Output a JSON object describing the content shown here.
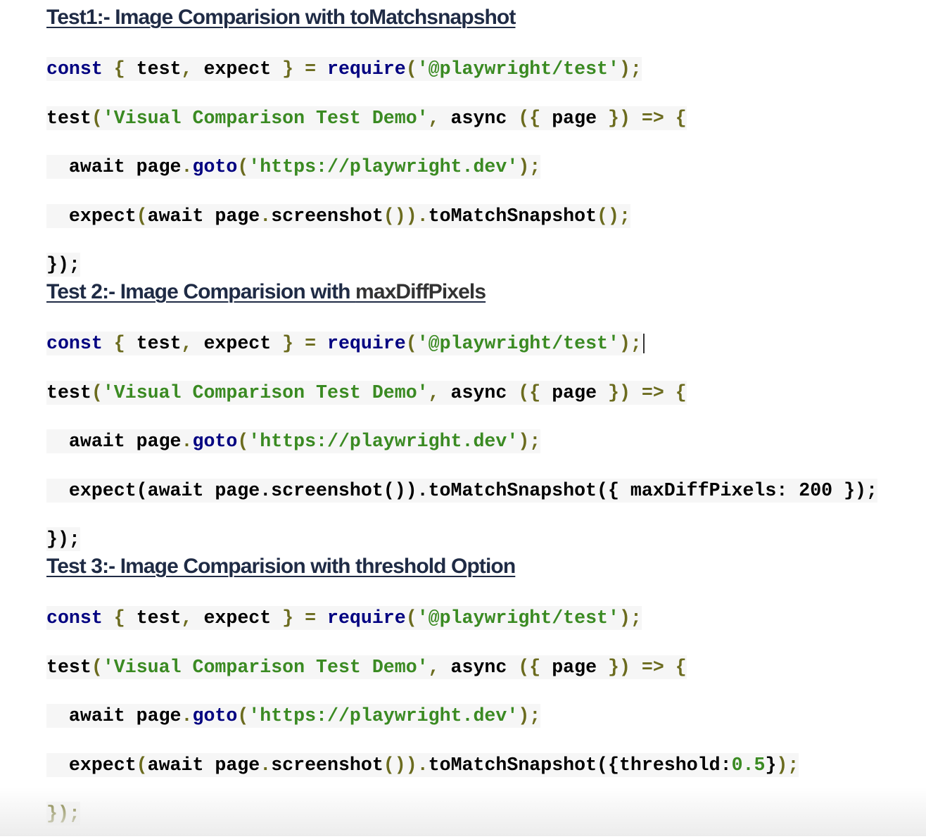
{
  "sections": [
    {
      "heading": "Test1:- Image Comparision with toMatchsnapshot",
      "heading_dark": "",
      "lines": [
        [
          [
            "const",
            "kw"
          ],
          [
            " { ",
            "p"
          ],
          [
            "test",
            "t"
          ],
          [
            ", ",
            "p"
          ],
          [
            "expect",
            "t"
          ],
          [
            " } = ",
            "p"
          ],
          [
            "require",
            "kw"
          ],
          [
            "(",
            "p"
          ],
          [
            "'@playwright/test'",
            "s"
          ],
          [
            ");",
            "p"
          ]
        ],
        [
          [
            "test",
            "t"
          ],
          [
            "(",
            "p"
          ],
          [
            "'Visual Comparison Test Demo'",
            "s"
          ],
          [
            ", ",
            "p"
          ],
          [
            "async",
            "t"
          ],
          [
            " ({ ",
            "p"
          ],
          [
            "page",
            "t"
          ],
          [
            " }) => {",
            "p"
          ]
        ],
        [
          [
            "  await page",
            "t"
          ],
          [
            ".",
            "p"
          ],
          [
            "goto",
            "kw"
          ],
          [
            "(",
            "p"
          ],
          [
            "'https://playwright.dev'",
            "s"
          ],
          [
            ");",
            "p"
          ]
        ],
        [
          [
            "  expect",
            "t"
          ],
          [
            "(",
            "p"
          ],
          [
            "await page",
            "t"
          ],
          [
            ".",
            "p"
          ],
          [
            "screenshot",
            "t"
          ],
          [
            "())",
            "p"
          ],
          [
            ".",
            "p"
          ],
          [
            "toMatchSnapshot",
            "t"
          ],
          [
            "();",
            "p"
          ]
        ],
        [
          [
            "});",
            "t"
          ]
        ]
      ]
    },
    {
      "heading": "Test 2:- Image Comparision with ",
      "heading_dark": "maxDiffPixels",
      "lines": [
        [
          [
            "const",
            "kw"
          ],
          [
            " { ",
            "p"
          ],
          [
            "test",
            "t"
          ],
          [
            ", ",
            "p"
          ],
          [
            "expect",
            "t"
          ],
          [
            " } = ",
            "p"
          ],
          [
            "require",
            "kw"
          ],
          [
            "(",
            "p"
          ],
          [
            "'@playwright/test'",
            "s"
          ],
          [
            ");",
            "p"
          ]
        ],
        [
          [
            "test",
            "t"
          ],
          [
            "(",
            "p"
          ],
          [
            "'Visual Comparison Test Demo'",
            "s"
          ],
          [
            ", ",
            "p"
          ],
          [
            "async",
            "t"
          ],
          [
            " ({ ",
            "p"
          ],
          [
            "page",
            "t"
          ],
          [
            " }) => {",
            "p"
          ]
        ],
        [
          [
            "  await page",
            "t"
          ],
          [
            ".",
            "p"
          ],
          [
            "goto",
            "kw"
          ],
          [
            "(",
            "p"
          ],
          [
            "'https://playwright.dev'",
            "s"
          ],
          [
            ");",
            "p"
          ]
        ],
        [
          [
            "  expect(await page.screenshot()).toMatchSnapshot({ maxDiffPixels: 200 });",
            "t"
          ]
        ],
        [
          [
            "});",
            "t"
          ]
        ]
      ]
    },
    {
      "heading": "Test 3:- Image Comparision with threshold Option",
      "heading_dark": "",
      "lines": [
        [
          [
            "const",
            "kw"
          ],
          [
            " { ",
            "p"
          ],
          [
            "test",
            "t"
          ],
          [
            ", ",
            "p"
          ],
          [
            "expect",
            "t"
          ],
          [
            " } = ",
            "p"
          ],
          [
            "require",
            "kw"
          ],
          [
            "(",
            "p"
          ],
          [
            "'@playwright/test'",
            "s"
          ],
          [
            ");",
            "p"
          ]
        ],
        [
          [
            "test",
            "t"
          ],
          [
            "(",
            "p"
          ],
          [
            "'Visual Comparison Test Demo'",
            "s"
          ],
          [
            ", ",
            "p"
          ],
          [
            "async",
            "t"
          ],
          [
            " ({ ",
            "p"
          ],
          [
            "page",
            "t"
          ],
          [
            " }) => {",
            "p"
          ]
        ],
        [
          [
            "  await page",
            "t"
          ],
          [
            ".",
            "p"
          ],
          [
            "goto",
            "kw"
          ],
          [
            "(",
            "p"
          ],
          [
            "'https://playwright.dev'",
            "s"
          ],
          [
            ");",
            "p"
          ]
        ],
        [
          [
            "  expect",
            "t"
          ],
          [
            "(",
            "p"
          ],
          [
            "await page",
            "t"
          ],
          [
            ".",
            "p"
          ],
          [
            "screenshot",
            "t"
          ],
          [
            "())",
            "p"
          ],
          [
            ".",
            "p"
          ],
          [
            "toMatchSnapshot",
            "t"
          ],
          [
            "({threshold:",
            "t"
          ],
          [
            "0.5",
            "s"
          ],
          [
            "}",
            "t"
          ],
          [
            ");",
            "p"
          ]
        ],
        [
          [
            "});",
            "p"
          ]
        ]
      ]
    }
  ],
  "colors": {
    "keyword": "#000080",
    "punctuation": "#6b6b1e",
    "string": "#3a8a22",
    "heading": "#1f2b45"
  }
}
